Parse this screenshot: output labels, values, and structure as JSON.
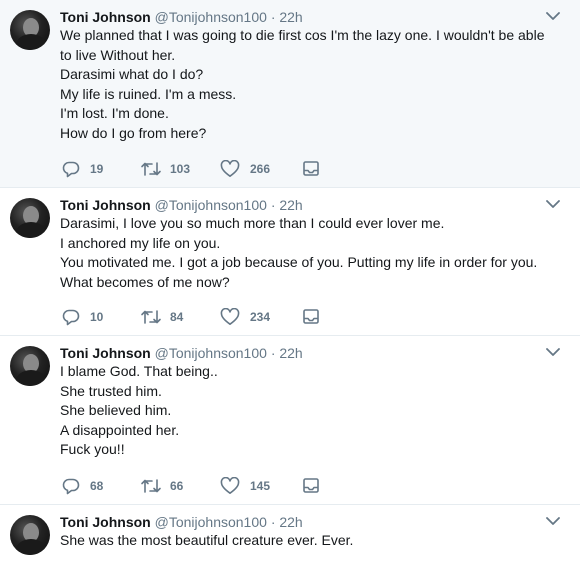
{
  "tweets": [
    {
      "name": "Toni Johnson",
      "handle": "@Tonijohnson100",
      "time": "· 22h",
      "lines": [
        "We planned that I was going to die first cos I'm the lazy one. I wouldn't be able",
        "to live Without her.",
        "Darasimi what do I do?",
        "My life is ruined. I'm a mess.",
        "I'm lost. I'm done.",
        "How do I go from here?"
      ],
      "replies": "19",
      "retweets": "103",
      "likes": "266"
    },
    {
      "name": "Toni Johnson",
      "handle": "@Tonijohnson100",
      "time": "· 22h",
      "lines": [
        "Darasimi, I love you so much more than I could ever lover me.",
        "I anchored my life on you.",
        "You motivated me. I got a job because of you. Putting my life in order for you.",
        "What becomes of me now?"
      ],
      "replies": "10",
      "retweets": "84",
      "likes": "234"
    },
    {
      "name": "Toni Johnson",
      "handle": "@Tonijohnson100",
      "time": "· 22h",
      "lines": [
        "I blame God. That being..",
        "She trusted him.",
        "She believed him.",
        "A disappointed her.",
        "Fuck you!!"
      ],
      "replies": "68",
      "retweets": "66",
      "likes": "145"
    },
    {
      "name": "Toni Johnson",
      "handle": "@Tonijohnson100",
      "time": "· 22h",
      "lines": [
        "She was the most beautiful creature ever. Ever."
      ]
    }
  ],
  "icons": {
    "reply": "reply-icon",
    "retweet": "retweet-icon",
    "like": "heart-icon",
    "dm": "envelope-icon",
    "caret": "chevron-down-icon"
  },
  "colors": {
    "highlight_bg": "#f5f8fa",
    "secondary_text": "#657786",
    "divider": "#e6ecf0"
  }
}
